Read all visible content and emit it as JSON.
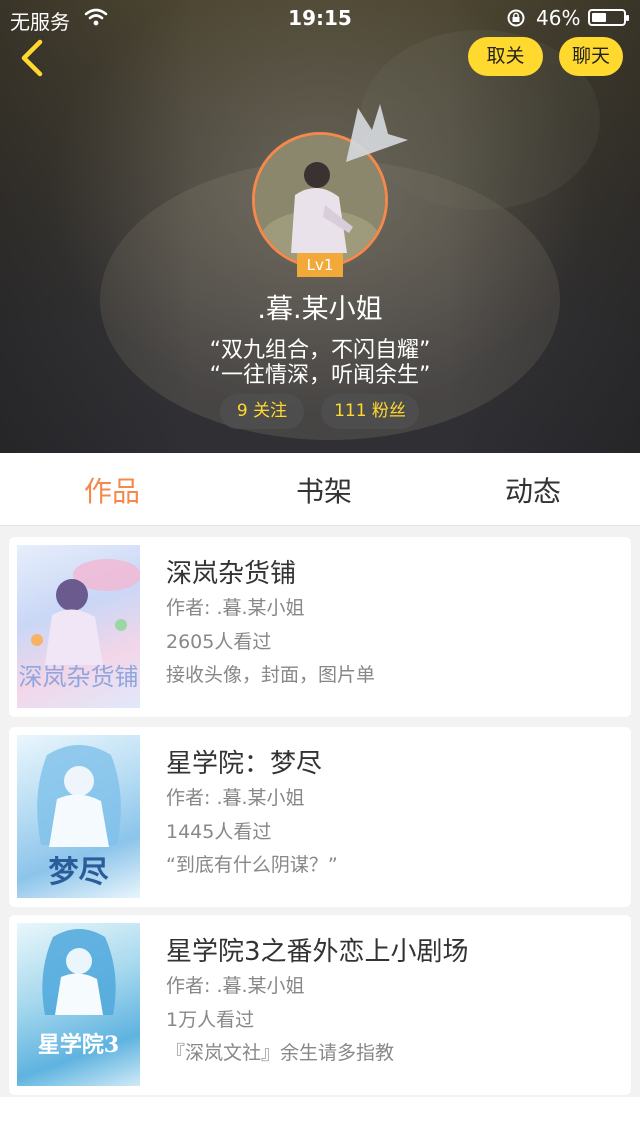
{
  "status_bar": {
    "carrier": "无服务",
    "time": "19:15",
    "battery_percent": "46%",
    "battery_level": 0.46
  },
  "header": {
    "unfollow_label": "取关",
    "chat_label": "聊天"
  },
  "profile": {
    "level": "Lv1",
    "username": ".暮.某小姐",
    "bio_line1": "“双九组合，不闪自耀”",
    "bio_line2": "“一往情深，听闻余生”",
    "following": "9 关注",
    "fans": "111 粉丝"
  },
  "tabs": {
    "works": "作品",
    "bookshelf": "书架",
    "feed": "动态",
    "active": "works"
  },
  "books": [
    {
      "title": "深岚杂货铺",
      "author": "作者: .暮.某小姐",
      "views": "2605人看过",
      "description": "接收头像，封面，图片单",
      "cover_text": "深岚杂货铺"
    },
    {
      "title": "星学院：梦尽",
      "author": "作者: .暮.某小姐",
      "views": "1445人看过",
      "description": "“到底有什么阴谋？”",
      "cover_text": "梦尽"
    },
    {
      "title": "星学院3之番外恋上小剧场",
      "author": "作者: .暮.某小姐",
      "views": "1万人看过",
      "description": "『深岚文社』余生请多指教",
      "cover_text": "星学院3"
    }
  ],
  "colors": {
    "accent": "#f5894d",
    "button_yellow": "#ffd92e",
    "level_badge": "#f3a83a"
  }
}
